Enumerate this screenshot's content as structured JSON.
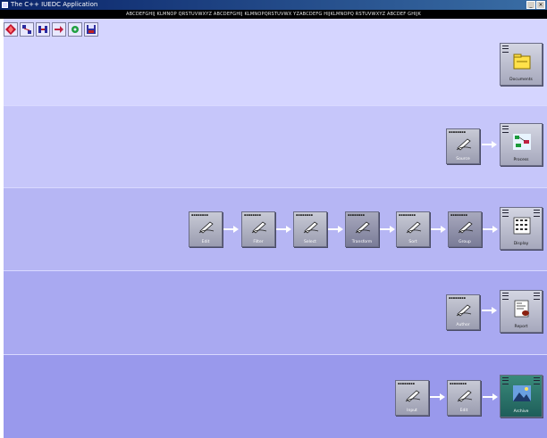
{
  "window": {
    "title": "The C++ IUEDC Application",
    "status_text": "ABCDEFGHIJ KLMNOP QRSTUVWXYZ ABCDEFGHIJ KLMNOPQRSTUVWX YZABCDEFG HIJKLMNOPQ RSTUVWXYZ ABCDEF GHIJK"
  },
  "toolbar": {
    "tools": [
      "diamond-icon",
      "network-icon",
      "split-icon",
      "arrow-icon",
      "gear-icon",
      "save-icon"
    ]
  },
  "lanes": [
    {
      "nodes": [],
      "target": {
        "label": "Documents",
        "art": "folder"
      }
    },
    {
      "nodes": [
        {
          "label": "Source",
          "dark": false
        }
      ],
      "target": {
        "label": "Process",
        "art": "flow"
      }
    },
    {
      "nodes": [
        {
          "label": "Edit",
          "dark": false
        },
        {
          "label": "Filter",
          "dark": false
        },
        {
          "label": "Select",
          "dark": false
        },
        {
          "label": "Transform",
          "dark": true
        },
        {
          "label": "Sort",
          "dark": false
        },
        {
          "label": "Group",
          "dark": true
        }
      ],
      "target": {
        "label": "Display",
        "art": "grid"
      }
    },
    {
      "nodes": [
        {
          "label": "Author",
          "dark": false
        }
      ],
      "target": {
        "label": "Report",
        "art": "doc"
      }
    },
    {
      "nodes": [
        {
          "label": "Input",
          "dark": false
        },
        {
          "label": "Edit",
          "dark": false
        }
      ],
      "target": {
        "label": "Archive",
        "art": "photo"
      }
    }
  ],
  "colors": {
    "lane1": "#d5d5ff",
    "lane2": "#c6c6fa",
    "lane3": "#b6b6f4",
    "lane4": "#a9a9f1",
    "lane5": "#9999ec"
  }
}
